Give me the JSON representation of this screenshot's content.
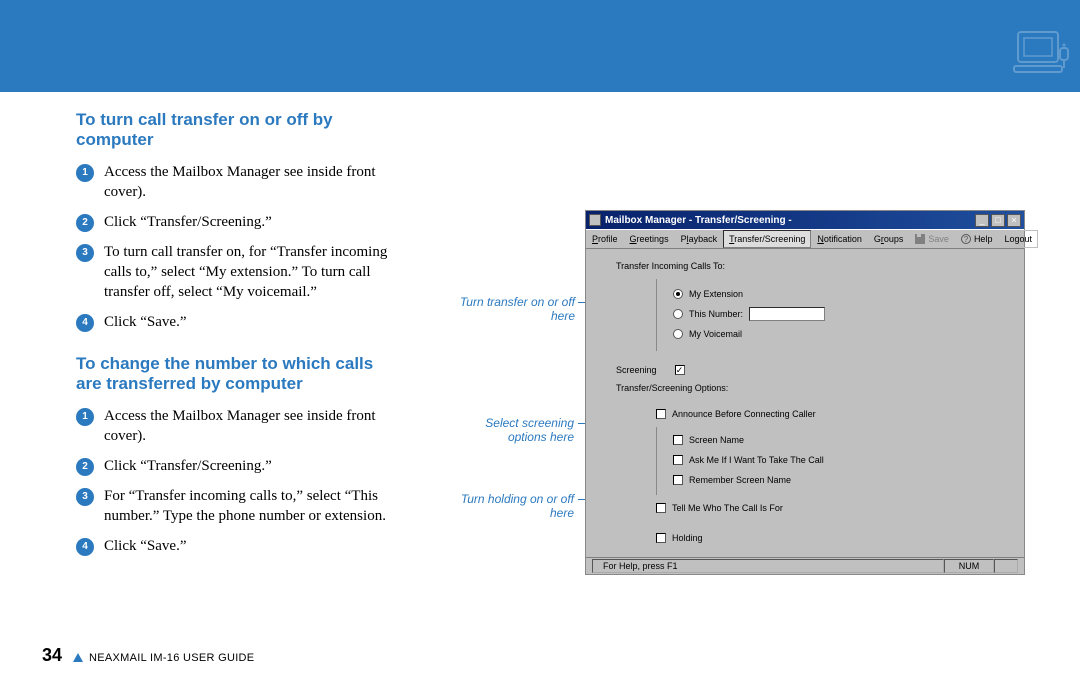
{
  "heading1": "To turn call transfer on or off by computer",
  "steps1": [
    "Access the Mailbox Manager see inside front cover).",
    "Click “Transfer/Screening.”",
    "To turn call transfer on, for “Transfer incoming calls to,” select “My extension.” To turn call transfer off, select “My voicemail.”",
    "Click “Save.”"
  ],
  "heading2": "To change the number to which calls are transferred by computer",
  "steps2": [
    "Access the Mailbox Manager see inside front cover).",
    "Click “Transfer/Screening.”",
    "For “Transfer incoming calls to,” select “This number.” Type the phone number or extension.",
    "Click “Save.”"
  ],
  "footer": {
    "page": "34",
    "guide": "NEAXMAIL IM-16 USER GUIDE"
  },
  "callouts": {
    "transfer": "Turn transfer on or off here",
    "screening": "Select screening options here",
    "holding": "Turn holding on or off here"
  },
  "window": {
    "title": "Mailbox Manager - Transfer/Screening -",
    "toolbar": {
      "profile": "Profile",
      "greetings": "Greetings",
      "playback": "Playback",
      "transfer": "Transfer/Screening",
      "notification": "Notification",
      "groups": "Groups",
      "save": "Save",
      "help": "Help",
      "logout": "Logout"
    },
    "body": {
      "transferLabel": "Transfer Incoming Calls To:",
      "r1": "My Extension",
      "r2": "This Number:",
      "r3": "My Voicemail",
      "screeningLabel": "Screening",
      "optionsLabel": "Transfer/Screening Options:",
      "o1": "Announce Before Connecting Caller",
      "o2": "Screen Name",
      "o3": "Ask Me If I Want To Take The Call",
      "o4": "Remember Screen Name",
      "o5": "Tell Me Who The Call Is For",
      "holding": "Holding"
    },
    "status": {
      "help": "For Help, press F1",
      "num": "NUM"
    }
  }
}
